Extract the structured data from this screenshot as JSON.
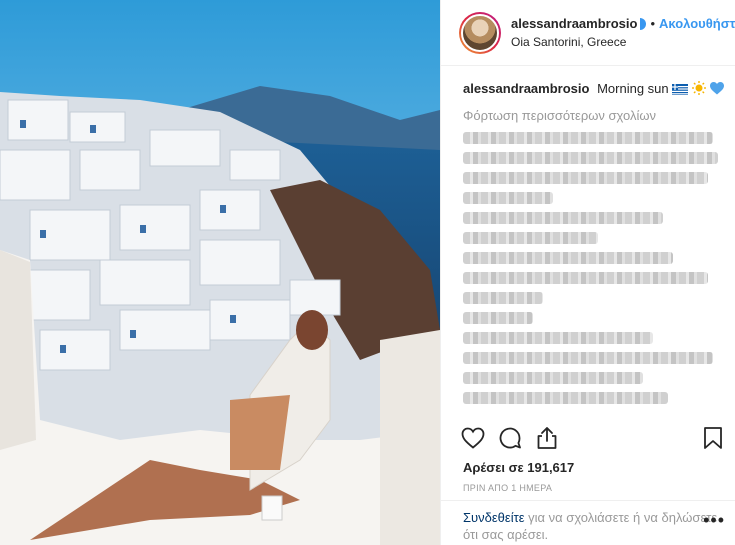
{
  "post": {
    "username": "alessandraambrosio",
    "follow_label": "Ακολουθήστε",
    "location": "Oia Santorini, Greece",
    "caption_user": "alessandraambrosio",
    "caption_text": "Morning sun",
    "caption_emojis": [
      "greek-flag",
      "sun",
      "blue-heart"
    ],
    "load_more": "Φόρτωση περισσότερων σχολίων",
    "likes": "Αρέσει σε 191,617",
    "time": "ΠΡΙΝ ΑΠΟ 1 ΗΜΕΡΑ",
    "login_link": "Συνδεθείτε",
    "login_text": "για να σχολιάσετε ή να δηλώσετε ότι σας αρέσει.",
    "more_label": "•••"
  },
  "colors": {
    "accent": "#3897f0",
    "link": "#003569",
    "muted": "#999999"
  },
  "icons": {
    "like": "heart-icon",
    "comment": "comment-icon",
    "share": "share-icon",
    "save": "bookmark-icon"
  }
}
